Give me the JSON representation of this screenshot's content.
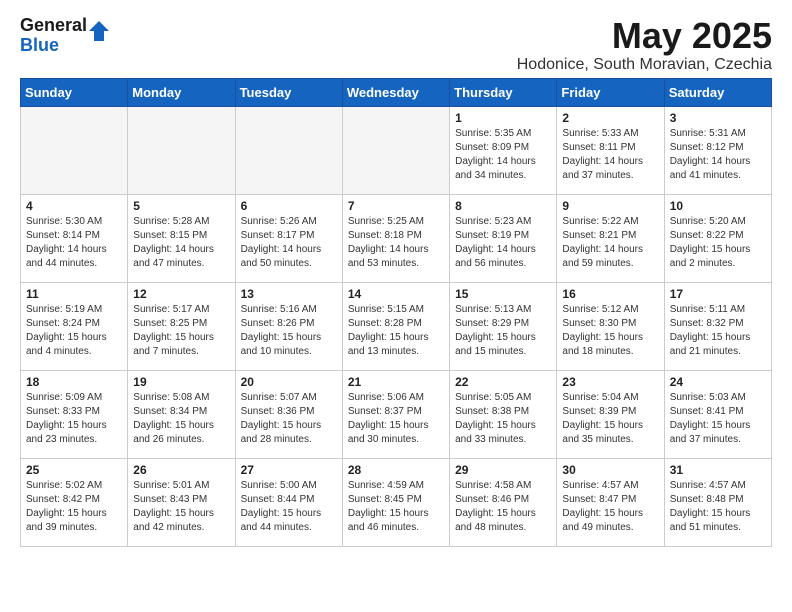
{
  "logo": {
    "general": "General",
    "blue": "Blue"
  },
  "header": {
    "month": "May 2025",
    "location": "Hodonice, South Moravian, Czechia"
  },
  "weekdays": [
    "Sunday",
    "Monday",
    "Tuesday",
    "Wednesday",
    "Thursday",
    "Friday",
    "Saturday"
  ],
  "weeks": [
    [
      {
        "day": "",
        "info": ""
      },
      {
        "day": "",
        "info": ""
      },
      {
        "day": "",
        "info": ""
      },
      {
        "day": "",
        "info": ""
      },
      {
        "day": "1",
        "info": "Sunrise: 5:35 AM\nSunset: 8:09 PM\nDaylight: 14 hours\nand 34 minutes."
      },
      {
        "day": "2",
        "info": "Sunrise: 5:33 AM\nSunset: 8:11 PM\nDaylight: 14 hours\nand 37 minutes."
      },
      {
        "day": "3",
        "info": "Sunrise: 5:31 AM\nSunset: 8:12 PM\nDaylight: 14 hours\nand 41 minutes."
      }
    ],
    [
      {
        "day": "4",
        "info": "Sunrise: 5:30 AM\nSunset: 8:14 PM\nDaylight: 14 hours\nand 44 minutes."
      },
      {
        "day": "5",
        "info": "Sunrise: 5:28 AM\nSunset: 8:15 PM\nDaylight: 14 hours\nand 47 minutes."
      },
      {
        "day": "6",
        "info": "Sunrise: 5:26 AM\nSunset: 8:17 PM\nDaylight: 14 hours\nand 50 minutes."
      },
      {
        "day": "7",
        "info": "Sunrise: 5:25 AM\nSunset: 8:18 PM\nDaylight: 14 hours\nand 53 minutes."
      },
      {
        "day": "8",
        "info": "Sunrise: 5:23 AM\nSunset: 8:19 PM\nDaylight: 14 hours\nand 56 minutes."
      },
      {
        "day": "9",
        "info": "Sunrise: 5:22 AM\nSunset: 8:21 PM\nDaylight: 14 hours\nand 59 minutes."
      },
      {
        "day": "10",
        "info": "Sunrise: 5:20 AM\nSunset: 8:22 PM\nDaylight: 15 hours\nand 2 minutes."
      }
    ],
    [
      {
        "day": "11",
        "info": "Sunrise: 5:19 AM\nSunset: 8:24 PM\nDaylight: 15 hours\nand 4 minutes."
      },
      {
        "day": "12",
        "info": "Sunrise: 5:17 AM\nSunset: 8:25 PM\nDaylight: 15 hours\nand 7 minutes."
      },
      {
        "day": "13",
        "info": "Sunrise: 5:16 AM\nSunset: 8:26 PM\nDaylight: 15 hours\nand 10 minutes."
      },
      {
        "day": "14",
        "info": "Sunrise: 5:15 AM\nSunset: 8:28 PM\nDaylight: 15 hours\nand 13 minutes."
      },
      {
        "day": "15",
        "info": "Sunrise: 5:13 AM\nSunset: 8:29 PM\nDaylight: 15 hours\nand 15 minutes."
      },
      {
        "day": "16",
        "info": "Sunrise: 5:12 AM\nSunset: 8:30 PM\nDaylight: 15 hours\nand 18 minutes."
      },
      {
        "day": "17",
        "info": "Sunrise: 5:11 AM\nSunset: 8:32 PM\nDaylight: 15 hours\nand 21 minutes."
      }
    ],
    [
      {
        "day": "18",
        "info": "Sunrise: 5:09 AM\nSunset: 8:33 PM\nDaylight: 15 hours\nand 23 minutes."
      },
      {
        "day": "19",
        "info": "Sunrise: 5:08 AM\nSunset: 8:34 PM\nDaylight: 15 hours\nand 26 minutes."
      },
      {
        "day": "20",
        "info": "Sunrise: 5:07 AM\nSunset: 8:36 PM\nDaylight: 15 hours\nand 28 minutes."
      },
      {
        "day": "21",
        "info": "Sunrise: 5:06 AM\nSunset: 8:37 PM\nDaylight: 15 hours\nand 30 minutes."
      },
      {
        "day": "22",
        "info": "Sunrise: 5:05 AM\nSunset: 8:38 PM\nDaylight: 15 hours\nand 33 minutes."
      },
      {
        "day": "23",
        "info": "Sunrise: 5:04 AM\nSunset: 8:39 PM\nDaylight: 15 hours\nand 35 minutes."
      },
      {
        "day": "24",
        "info": "Sunrise: 5:03 AM\nSunset: 8:41 PM\nDaylight: 15 hours\nand 37 minutes."
      }
    ],
    [
      {
        "day": "25",
        "info": "Sunrise: 5:02 AM\nSunset: 8:42 PM\nDaylight: 15 hours\nand 39 minutes."
      },
      {
        "day": "26",
        "info": "Sunrise: 5:01 AM\nSunset: 8:43 PM\nDaylight: 15 hours\nand 42 minutes."
      },
      {
        "day": "27",
        "info": "Sunrise: 5:00 AM\nSunset: 8:44 PM\nDaylight: 15 hours\nand 44 minutes."
      },
      {
        "day": "28",
        "info": "Sunrise: 4:59 AM\nSunset: 8:45 PM\nDaylight: 15 hours\nand 46 minutes."
      },
      {
        "day": "29",
        "info": "Sunrise: 4:58 AM\nSunset: 8:46 PM\nDaylight: 15 hours\nand 48 minutes."
      },
      {
        "day": "30",
        "info": "Sunrise: 4:57 AM\nSunset: 8:47 PM\nDaylight: 15 hours\nand 49 minutes."
      },
      {
        "day": "31",
        "info": "Sunrise: 4:57 AM\nSunset: 8:48 PM\nDaylight: 15 hours\nand 51 minutes."
      }
    ]
  ]
}
